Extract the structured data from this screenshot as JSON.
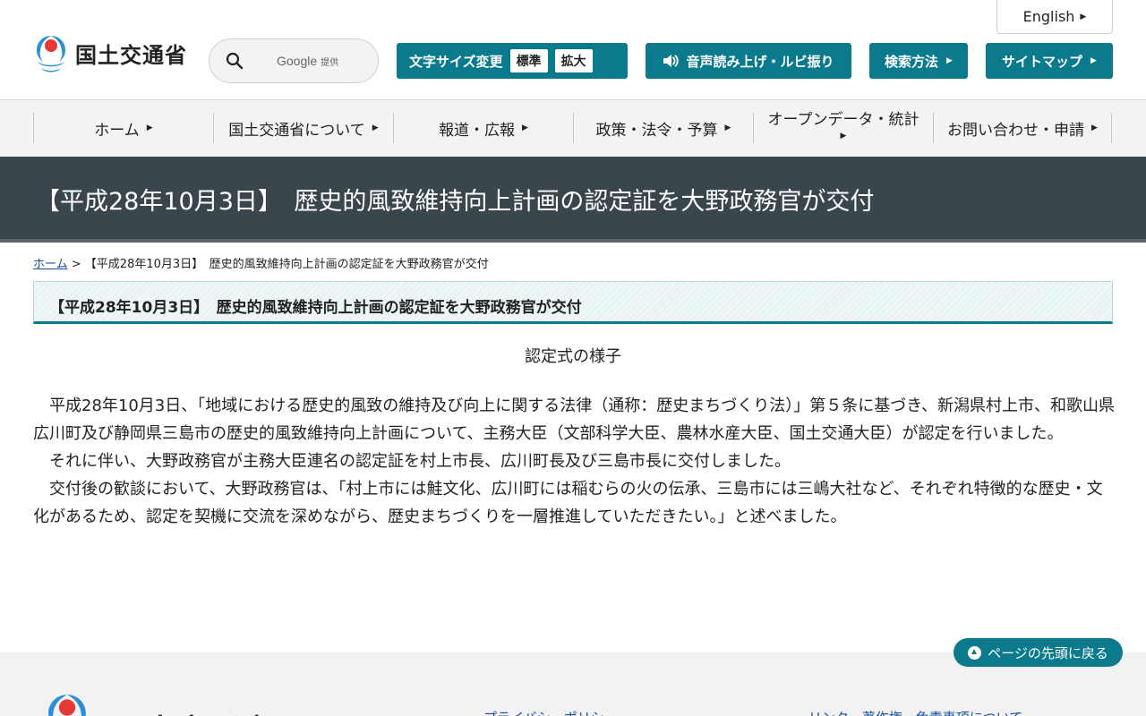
{
  "header": {
    "english_label": "English",
    "logo_text": "国土交通省",
    "search": {
      "provider": "Google",
      "provider_suffix": "提供"
    },
    "font_size": {
      "label": "文字サイズ変更",
      "standard": "標準",
      "large": "拡大"
    },
    "voice_label": "音声読み上げ・ルビ振り",
    "howto_label": "検索方法",
    "sitemap_label": "サイトマップ"
  },
  "nav": {
    "items": [
      {
        "label": "ホーム"
      },
      {
        "label": "国土交通省について"
      },
      {
        "label": "報道・広報"
      },
      {
        "label": "政策・法令・予算"
      },
      {
        "label": "オープンデータ・統計"
      },
      {
        "label": "お問い合わせ・申請"
      }
    ]
  },
  "page": {
    "title": "【平成28年10月3日】　歴史的風致維持向上計画の認定証を大野政務官が交付",
    "breadcrumb": {
      "home": "ホーム",
      "separator": " > ",
      "current": "【平成28年10月3日】　歴史的風致維持向上計画の認定証を大野政務官が交付"
    },
    "heading": "【平成28年10月3日】　歴史的風致維持向上計画の認定証を大野政務官が交付",
    "caption": "認定式の様子",
    "paragraphs": [
      "平成28年10月3日、「地域における歴史的風致の維持及び向上に関する法律（通称：歴史まちづくり法）」第５条に基づき、新潟県村上市、和歌山県広川町及び静岡県三島市の歴史的風致維持向上計画について、主務大臣（文部科学大臣、農林水産大臣、国土交通大臣）が認定を行いました。",
      "それに伴い、大野政務官が主務大臣連名の認定証を村上市長、広川町長及び三島市長に交付しました。",
      "交付後の歓談において、大野政務官は、「村上市には鮭文化、広川町には稲むらの火の伝承、三島市には三嶋大社など、それぞれ特徴的な歴史・文化があるため、認定を契機に交流を深めながら、歴史まちづくりを一層推進していただきたい。」と述べました。"
    ]
  },
  "footer": {
    "page_top_label": "ページの先頭に戻る",
    "logo_text": "国土交通省",
    "links": [
      "プライバシーポリシー",
      "リンク・著作権・免責事項について"
    ]
  },
  "colors": {
    "brand_teal": "#0b7a8c",
    "title_band": "#39474c",
    "nav_background": "#f3f3f3",
    "link_blue": "#1a4fa0"
  }
}
